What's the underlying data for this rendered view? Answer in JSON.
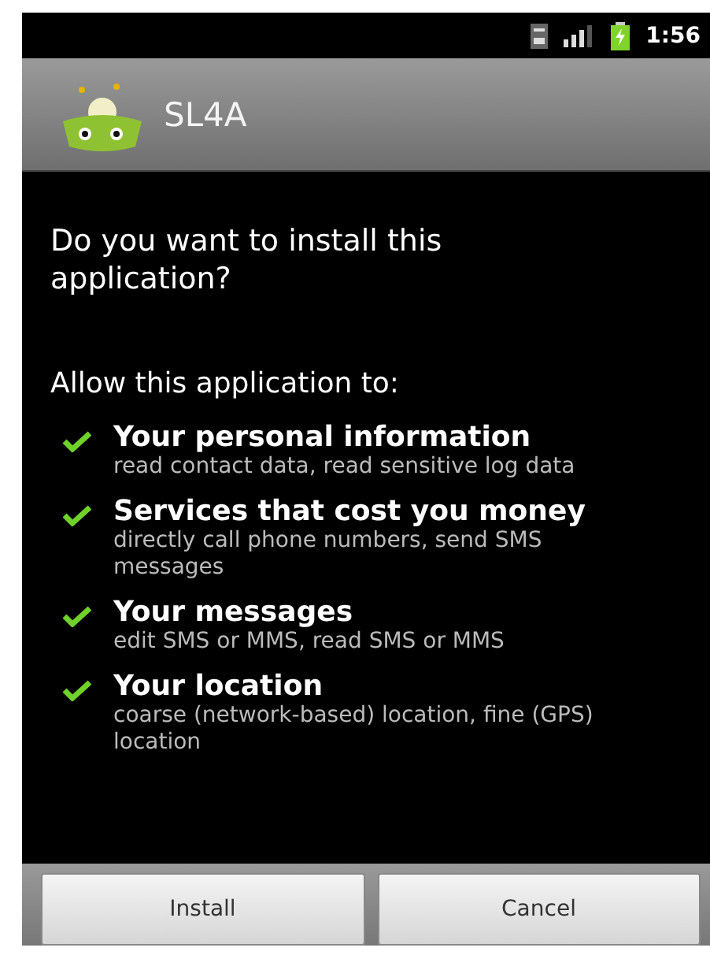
{
  "status_bar": {
    "time": "1:56"
  },
  "app": {
    "name": "SL4A"
  },
  "question": "Do you want to install this application?",
  "allow_heading": "Allow this application to:",
  "permissions": [
    {
      "title": "Your personal information",
      "detail": "read contact data, read sensitive log data"
    },
    {
      "title": "Services that cost you money",
      "detail": "directly call phone numbers, send SMS messages"
    },
    {
      "title": "Your messages",
      "detail": "edit SMS or MMS, read SMS or MMS"
    },
    {
      "title": "Your location",
      "detail": "coarse (network-based) location, fine (GPS) location"
    }
  ],
  "buttons": [
    "Install",
    "Cancel"
  ]
}
